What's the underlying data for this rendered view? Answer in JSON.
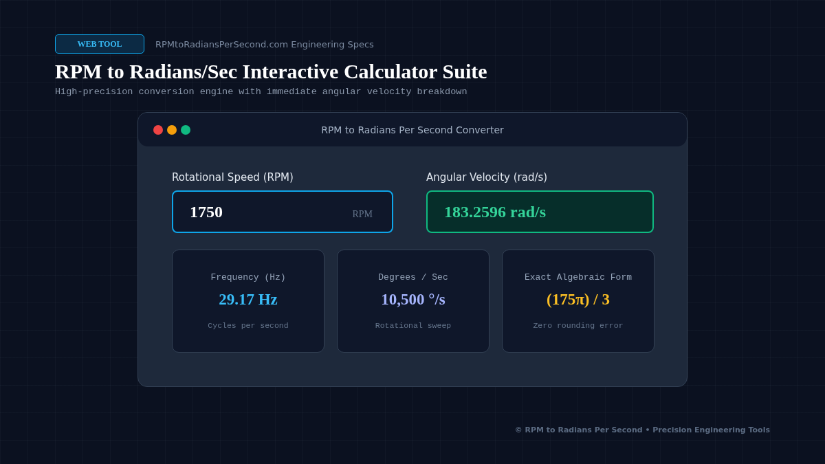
{
  "header": {
    "badge": "WEB TOOL",
    "site": "RPMtoRadiansPerSecond.com Engineering Specs",
    "title": "RPM to Radians/Sec Interactive Calculator Suite",
    "subtitle": "High-precision conversion engine with immediate angular velocity breakdown"
  },
  "window": {
    "title": "RPM to Radians Per Second Converter"
  },
  "input": {
    "label": "Rotational Speed (RPM)",
    "value": "1750",
    "unit": "RPM"
  },
  "output": {
    "label": "Angular Velocity (rad/s)",
    "value": "183.2596 rad/s"
  },
  "results": [
    {
      "label": "Frequency (Hz)",
      "value": "29.17 Hz",
      "note": "Cycles per second",
      "color": "#38bdf8"
    },
    {
      "label": "Degrees / Sec",
      "value": "10,500 °/s",
      "note": "Rotational sweep",
      "color": "#a5b4fc"
    },
    {
      "label": "Exact Algebraic Form",
      "value": "(175π) / 3",
      "note": "Zero rounding error",
      "color": "#fbbf24"
    }
  ],
  "footer": "© RPM to Radians Per Second • Precision Engineering Tools"
}
